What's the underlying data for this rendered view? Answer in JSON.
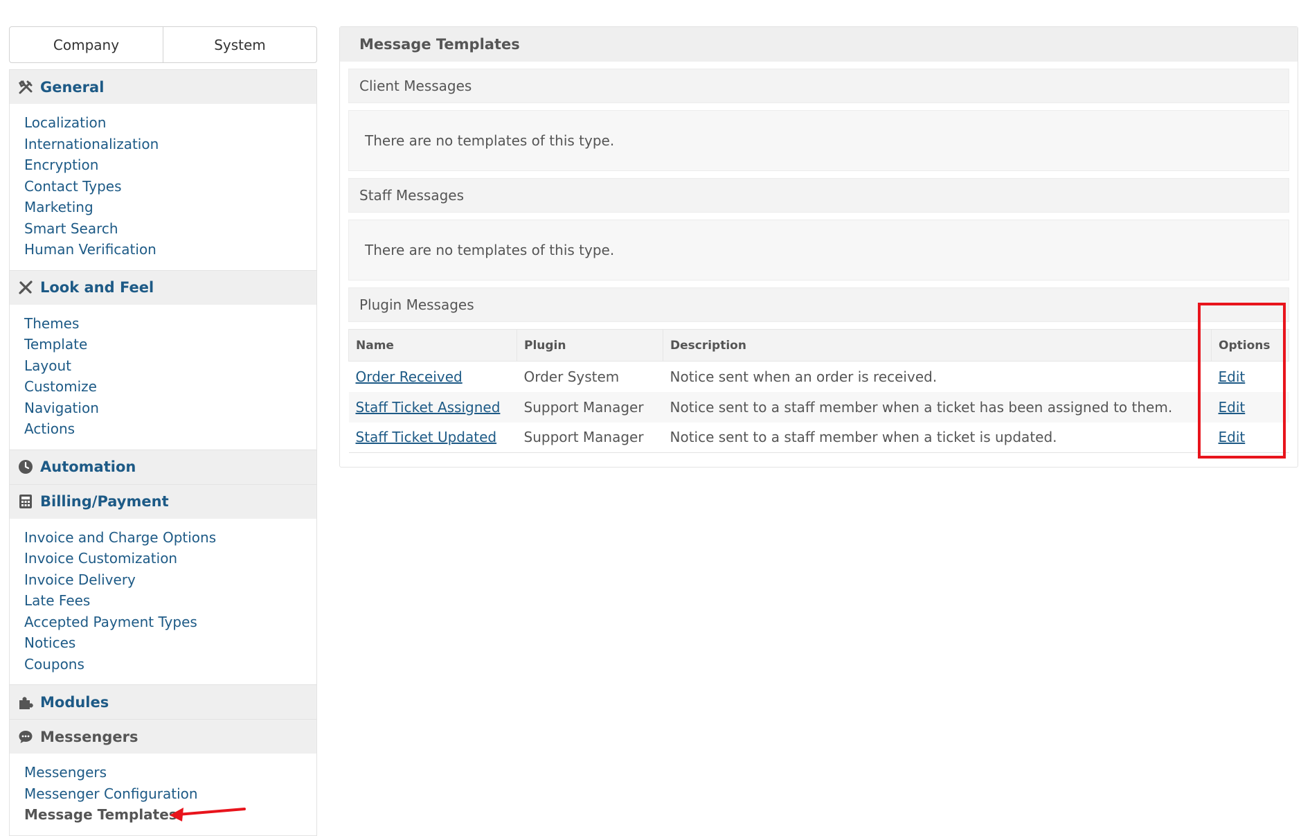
{
  "tabs": [
    "Company",
    "System"
  ],
  "sidebar": {
    "sections": [
      {
        "title": "General",
        "icon": "wrench-screwdriver-icon",
        "items": [
          "Localization",
          "Internationalization",
          "Encryption",
          "Contact Types",
          "Marketing",
          "Smart Search",
          "Human Verification"
        ]
      },
      {
        "title": "Look and Feel",
        "icon": "pencil-ruler-icon",
        "items": [
          "Themes",
          "Template",
          "Layout",
          "Customize",
          "Navigation",
          "Actions"
        ]
      },
      {
        "title": "Automation",
        "icon": "clock-icon",
        "items": []
      },
      {
        "title": "Billing/Payment",
        "icon": "calculator-icon",
        "items": [
          "Invoice and Charge Options",
          "Invoice Customization",
          "Invoice Delivery",
          "Late Fees",
          "Accepted Payment Types",
          "Notices",
          "Coupons"
        ]
      },
      {
        "title": "Modules",
        "icon": "puzzle-icon",
        "items": []
      },
      {
        "title": "Messengers",
        "icon": "chat-bubble-icon",
        "items": [
          "Messengers",
          "Messenger Configuration",
          "Message Templates"
        ]
      }
    ],
    "active_item": "Message Templates"
  },
  "main": {
    "title": "Message Templates",
    "client_messages": {
      "header": "Client Messages",
      "empty_text": "There are no templates of this type."
    },
    "staff_messages": {
      "header": "Staff Messages",
      "empty_text": "There are no templates of this type."
    },
    "plugin_messages": {
      "header": "Plugin Messages",
      "columns": [
        "Name",
        "Plugin",
        "Description",
        "Options"
      ],
      "rows": [
        {
          "name": "Order Received",
          "plugin": "Order System",
          "description": "Notice sent when an order is received.",
          "option": "Edit"
        },
        {
          "name": "Staff Ticket Assigned",
          "plugin": "Support Manager",
          "description": "Notice sent to a staff member when a ticket has been assigned to them.",
          "option": "Edit"
        },
        {
          "name": "Staff Ticket Updated",
          "plugin": "Support Manager",
          "description": "Notice sent to a staff member when a ticket is updated.",
          "option": "Edit"
        }
      ]
    }
  },
  "colors": {
    "link": "#1d5a86",
    "annotation": "#e8141c",
    "header_bg": "#efefef"
  }
}
